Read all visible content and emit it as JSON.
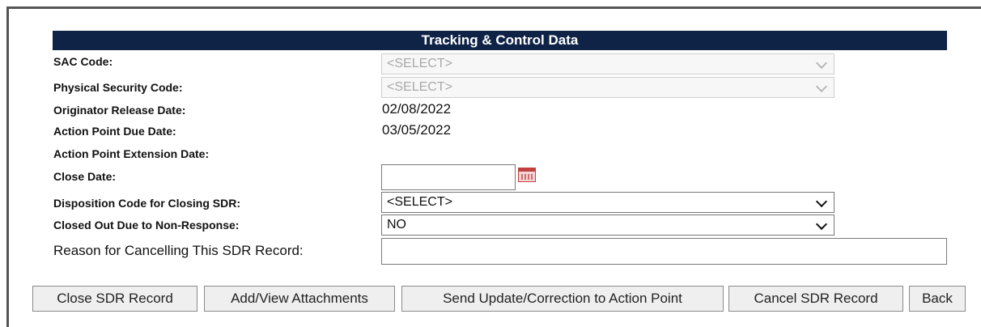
{
  "section": {
    "title": "Tracking & Control Data"
  },
  "fields": {
    "sac_code": {
      "label": "SAC Code:",
      "value": "<SELECT>"
    },
    "physical_security_code": {
      "label": "Physical Security Code:",
      "value": "<SELECT>"
    },
    "originator_release_date": {
      "label": "Originator Release Date:",
      "value": "02/08/2022"
    },
    "action_point_due_date": {
      "label": "Action Point Due Date:",
      "value": "03/05/2022"
    },
    "action_point_extension_date": {
      "label": "Action Point Extension Date:",
      "value": ""
    },
    "close_date": {
      "label": "Close Date:",
      "value": ""
    },
    "disposition_code": {
      "label": "Disposition Code for Closing SDR:",
      "value": "<SELECT>"
    },
    "closed_out_non_response": {
      "label": "Closed Out Due to Non-Response:",
      "value": "NO"
    },
    "reason_for_cancelling": {
      "label": "Reason for Cancelling This SDR Record:",
      "value": ""
    }
  },
  "buttons": {
    "close_sdr": "Close SDR Record",
    "attachments": "Add/View Attachments",
    "send_update": "Send Update/Correction to Action Point",
    "cancel_sdr": "Cancel SDR Record",
    "back": "Back"
  },
  "icons": {
    "calendar": "calendar-icon",
    "dropdown": "chevron-down-icon"
  },
  "colors": {
    "header_bg": "#0f2347",
    "header_text": "#ffffff"
  }
}
